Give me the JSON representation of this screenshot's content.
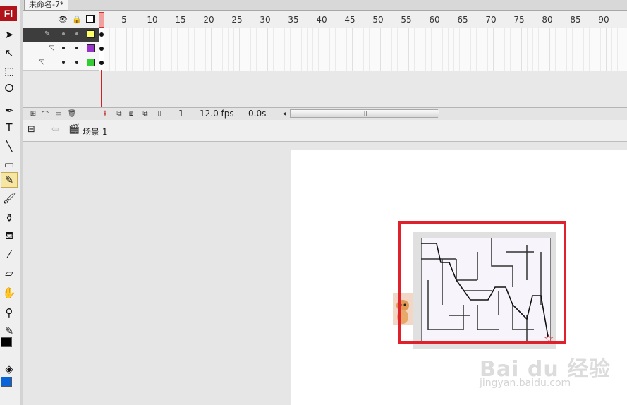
{
  "app": {
    "logo_text": "Fl",
    "document_tab": "未命名-7*"
  },
  "toolbox": {
    "tools": [
      {
        "name": "selection-tool",
        "glyph": "➤"
      },
      {
        "name": "subselection-tool",
        "glyph": "↖"
      },
      {
        "name": "free-transform-tool",
        "glyph": "⬚"
      },
      {
        "name": "lasso-tool",
        "glyph": "ⵔ"
      },
      {
        "name": "pen-tool",
        "glyph": "✒"
      },
      {
        "name": "text-tool",
        "glyph": "T"
      },
      {
        "name": "line-tool",
        "glyph": "╲"
      },
      {
        "name": "rectangle-tool",
        "glyph": "▭"
      },
      {
        "name": "pencil-tool",
        "glyph": "✎"
      },
      {
        "name": "brush-tool",
        "glyph": "🖌"
      },
      {
        "name": "ink-bottle-tool",
        "glyph": "⚱"
      },
      {
        "name": "paint-bucket-tool",
        "glyph": "⛾"
      },
      {
        "name": "eyedropper-tool",
        "glyph": "⁄"
      },
      {
        "name": "eraser-tool",
        "glyph": "▱"
      },
      {
        "name": "hand-tool",
        "glyph": "✋"
      },
      {
        "name": "zoom-tool",
        "glyph": "⚲"
      },
      {
        "name": "stroke-color-icon",
        "glyph": "✎"
      },
      {
        "name": "fill-color-icon",
        "glyph": "◈"
      }
    ],
    "active_tool": "pencil-tool",
    "stroke_color": "#000000",
    "fill_color": "#0a64d8"
  },
  "timeline": {
    "frame_numbers": [
      "1",
      "5",
      "10",
      "15",
      "20",
      "25",
      "30",
      "35",
      "40",
      "45",
      "50",
      "55",
      "60",
      "65",
      "70",
      "75",
      "80",
      "85",
      "90"
    ],
    "layers": [
      {
        "name": "layer-1",
        "color": "#ffff66",
        "selected": true
      },
      {
        "name": "layer-2",
        "color": "#9933cc",
        "selected": false
      },
      {
        "name": "layer-3",
        "color": "#33cc33",
        "selected": false
      }
    ],
    "current_frame": "1",
    "fps": "12.0 fps",
    "elapsed": "0.0s",
    "scroll_grip": "|||"
  },
  "editbar": {
    "scene": "场景 1"
  },
  "watermark": {
    "logo": "Bai du 经验",
    "url": "jingyan.baidu.com"
  }
}
